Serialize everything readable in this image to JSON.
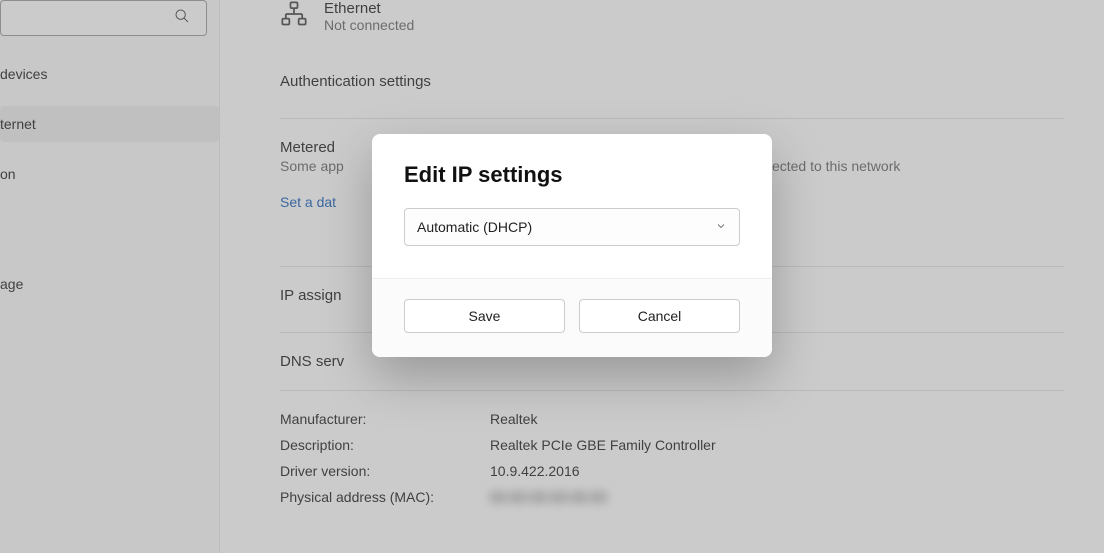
{
  "sidebar": {
    "search_placeholder": "",
    "items": [
      {
        "label": "devices"
      },
      {
        "label": "ternet",
        "active": true
      },
      {
        "label": "on"
      },
      {
        "label": "age"
      }
    ]
  },
  "ethernet": {
    "title": "Ethernet",
    "status": "Not connected"
  },
  "auth_heading": "Authentication settings",
  "metered": {
    "title": "Metered",
    "subtitle_prefix": "Some app",
    "subtitle_suffix": "connected to this network"
  },
  "data_limit_link": "Set a dat",
  "ip_assign": "IP assign",
  "dns_server": "DNS serv",
  "details": {
    "manufacturer_label": "Manufacturer:",
    "manufacturer_value": "Realtek",
    "description_label": "Description:",
    "description_value": "Realtek PCIe GBE Family Controller",
    "driver_label": "Driver version:",
    "driver_value": "10.9.422.2016",
    "mac_label": "Physical address (MAC):",
    "mac_value": "00-00-00-00-00-00"
  },
  "dialog": {
    "title": "Edit IP settings",
    "dropdown_value": "Automatic (DHCP)",
    "save_label": "Save",
    "cancel_label": "Cancel"
  }
}
